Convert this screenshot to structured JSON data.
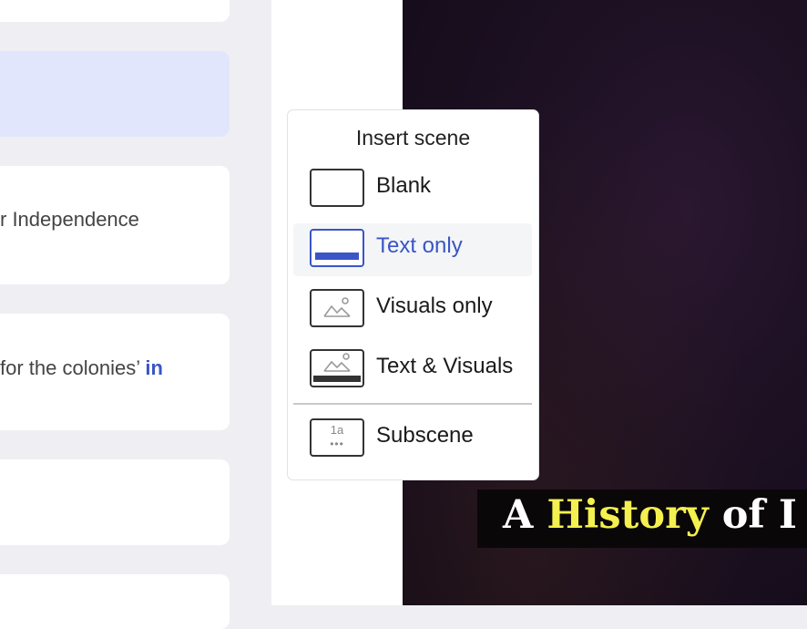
{
  "scenes": {
    "card3": {
      "text": "r Independence"
    },
    "card4": {
      "text": "for the colonies’",
      "highlight": "in"
    }
  },
  "video": {
    "caption": {
      "word1": "A",
      "word2": "History",
      "word3": "of I"
    }
  },
  "insert_menu": {
    "title": "Insert scene",
    "items": [
      {
        "label": "Blank",
        "icon": "blank-scene-icon"
      },
      {
        "label": "Text only",
        "icon": "text-only-scene-icon",
        "active": true
      },
      {
        "label": "Visuals only",
        "icon": "visuals-only-scene-icon"
      },
      {
        "label": "Text & Visuals",
        "icon": "text-visuals-scene-icon"
      },
      {
        "label": "Subscene",
        "icon": "subscene-icon"
      }
    ],
    "subscene_thumb_label": "1a"
  },
  "colors": {
    "accent": "#3a55c7",
    "selected_card": "#e1e6fd",
    "caption_highlight": "#f3f04f"
  }
}
